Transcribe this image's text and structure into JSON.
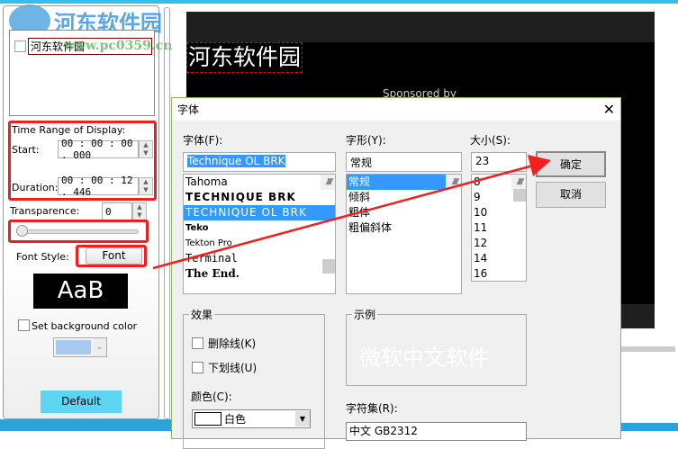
{
  "watermark": {
    "logo_text": "河东软件园",
    "url": "www.pc0359.cn"
  },
  "left_panel": {
    "title_item": "河东软件园",
    "time_range_label": "Time Range of Display:",
    "start_label": "Start:",
    "start_value": "00 : 00 : 00 . 000",
    "duration_label": "Duration:",
    "duration_value": "00 : 00 : 12 . 446",
    "transparence_label": "Transparence:",
    "transparence_value": "0",
    "slider_value": 0,
    "font_style_label": "Font Style:",
    "font_button": "Font",
    "preview_text": "AaB",
    "bg_color_label": "Set background color",
    "bg_color": "#a8c8f0",
    "default_button": "Default"
  },
  "video": {
    "overlay_text": "河东软件园",
    "sponsored": "Sponsored by"
  },
  "dialog": {
    "title": "字体",
    "font_label": "字体(F):",
    "font_value": "Technique OL BRK",
    "fonts": [
      "Tahoma",
      "TECHNIQUE BRK",
      "TECHNIQUE OL BRK",
      "Teko",
      "Tekton Pro",
      "Terminal",
      "The End."
    ],
    "style_label": "字形(Y):",
    "style_value": "常规",
    "styles": [
      "常规",
      "倾斜",
      "粗体",
      "粗偏斜体"
    ],
    "size_label": "大小(S):",
    "size_value": "23",
    "sizes": [
      "8",
      "9",
      "10",
      "11",
      "12",
      "14",
      "16"
    ],
    "ok": "确定",
    "cancel": "取消",
    "effects_label": "效果",
    "strike_label": "删除线(K)",
    "underline_label": "下划线(U)",
    "color_label": "颜色(C):",
    "color_value": "白色",
    "sample_label": "示例",
    "sample_text": "微软中文软件",
    "charset_label": "字符集(R):",
    "charset_value": "中文 GB2312"
  }
}
